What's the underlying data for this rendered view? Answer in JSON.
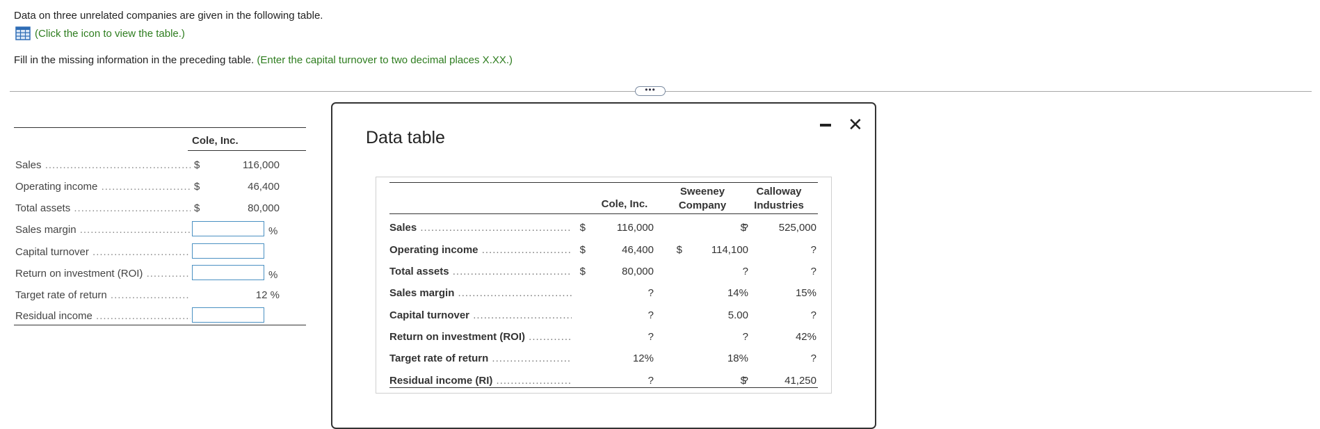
{
  "intro_text": "Data on three unrelated companies are given in the following table.",
  "table_link": {
    "icon": "table-grid-icon",
    "text": "(Click the icon to view the table.)"
  },
  "instruction": {
    "main": "Fill in the missing information in the preceding table.",
    "hint": "(Enter the capital turnover to two decimal places X.XX.)"
  },
  "resize_handle": "•••",
  "answer_table": {
    "header": "Cole, Inc.",
    "rows": [
      {
        "label": "Sales",
        "dollar": "$",
        "value": "116,000"
      },
      {
        "label": "Operating income",
        "dollar": "$",
        "value": "46,400"
      },
      {
        "label": "Total assets",
        "dollar": "$",
        "value": "80,000"
      },
      {
        "label": "Sales margin",
        "input": "",
        "unit": "%"
      },
      {
        "label": "Capital turnover",
        "input": ""
      },
      {
        "label": "Return on investment (ROI)",
        "input": "",
        "unit": "%"
      },
      {
        "label": "Target rate of return",
        "value": "12 %"
      },
      {
        "label": "Residual income",
        "input": ""
      }
    ]
  },
  "modal": {
    "title": "Data table",
    "minimize": "minimize",
    "close": "✕",
    "columns": [
      "Cole, Inc.",
      "Sweeney Company",
      "Calloway Industries"
    ],
    "column_lines": [
      [
        "Sweeney",
        "Company"
      ],
      [
        "Calloway",
        "Industries"
      ]
    ],
    "rows": [
      {
        "label": "Sales",
        "d1": "$",
        "c1": "116,000",
        "d2": "",
        "c2": "?",
        "d3": "$",
        "c3": "525,000"
      },
      {
        "label": "Operating income",
        "d1": "$",
        "c1": "46,400",
        "d2": "$",
        "c2": "114,100",
        "d3": "",
        "c3": "?"
      },
      {
        "label": "Total assets",
        "d1": "$",
        "c1": "80,000",
        "d2": "",
        "c2": "?",
        "d3": "",
        "c3": "?"
      },
      {
        "label": "Sales margin",
        "d1": "",
        "c1": "?",
        "d2": "",
        "c2": "14%",
        "d3": "",
        "c3": "15%"
      },
      {
        "label": "Capital turnover",
        "d1": "",
        "c1": "?",
        "d2": "",
        "c2": "5.00",
        "d3": "",
        "c3": "?"
      },
      {
        "label": "Return on investment (ROI)",
        "d1": "",
        "c1": "?",
        "d2": "",
        "c2": "?",
        "d3": "",
        "c3": "42%"
      },
      {
        "label": "Target rate of return",
        "d1": "",
        "c1": "12%",
        "d2": "",
        "c2": "18%",
        "d3": "",
        "c3": "?"
      },
      {
        "label": "Residual income (RI)",
        "d1": "",
        "c1": "?",
        "d2": "",
        "c2": "?",
        "d3": "$",
        "c3": "41,250"
      }
    ]
  }
}
